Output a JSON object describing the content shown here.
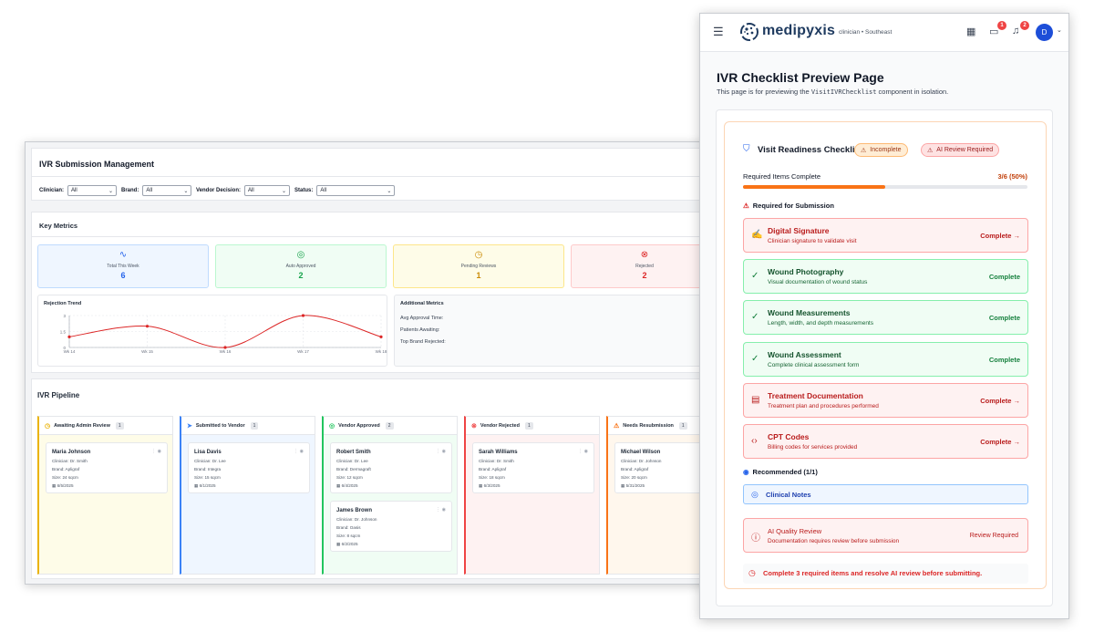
{
  "back": {
    "title": "IVR Submission Management",
    "filters": [
      {
        "label": "Clinician:",
        "value": "All"
      },
      {
        "label": "Brand:",
        "value": "All"
      },
      {
        "label": "Vendor Decision:",
        "value": "All"
      },
      {
        "label": "Status:",
        "value": "All"
      }
    ],
    "key_metrics": {
      "title": "Key Metrics",
      "cards": [
        {
          "label": "Total This Week",
          "value": "6",
          "color": "#2563eb"
        },
        {
          "label": "Auto Approved",
          "value": "2",
          "color": "#16a34a"
        },
        {
          "label": "Pending Reviews",
          "value": "1",
          "color": "#ca8a04"
        },
        {
          "label": "Rejected",
          "value": "2",
          "color": "#dc2626"
        }
      ]
    },
    "rejection_trend": {
      "title": "Rejection Trend"
    },
    "additional_metrics": {
      "title": "Additional Metrics",
      "rows": [
        "Avg Approval Time:",
        "Patients Awaiting:",
        "Top Brand Rejected:"
      ]
    },
    "pipeline": {
      "title": "IVR Pipeline",
      "columns": [
        {
          "title": "Awaiting Admin Review",
          "count": "1",
          "color": "#eab308",
          "bg": "#fefce8",
          "cards": [
            {
              "name": "Maria Johnson",
              "clinician": "Clinician: Dr. Smith",
              "brand": "Brand: Apligraf",
              "size": "Size: 24 sqcm",
              "date": "6/5/2025"
            }
          ]
        },
        {
          "title": "Submitted to Vendor",
          "count": "1",
          "color": "#3b82f6",
          "bg": "#eff6ff",
          "cards": [
            {
              "name": "Lisa Davis",
              "clinician": "Clinician: Dr. Lee",
              "brand": "Brand: Integra",
              "size": "Size: 15 sqcm",
              "date": "6/1/2025"
            }
          ]
        },
        {
          "title": "Vendor Approved",
          "count": "2",
          "color": "#22c55e",
          "bg": "#f0fdf4",
          "cards": [
            {
              "name": "Robert Smith",
              "clinician": "Clinician: Dr. Lee",
              "brand": "Brand: Dermagraft",
              "size": "Size: 12 sqcm",
              "date": "6/4/2025"
            },
            {
              "name": "James Brown",
              "clinician": "Clinician: Dr. Johnson",
              "brand": "Brand: Oasis",
              "size": "Size: 8 sqcm",
              "date": "6/2/2025"
            }
          ]
        },
        {
          "title": "Vendor Rejected",
          "count": "1",
          "color": "#ef4444",
          "bg": "#fef2f2",
          "cards": [
            {
              "name": "Sarah Williams",
              "clinician": "Clinician: Dr. Smith",
              "brand": "Brand: Apligraf",
              "size": "Size: 18 sqcm",
              "date": "6/3/2025"
            }
          ]
        },
        {
          "title": "Needs Resubmission",
          "count": "1",
          "color": "#f97316",
          "bg": "#fff7ed",
          "cards": [
            {
              "name": "Michael Wilson",
              "clinician": "Clinician: Dr. Johnson",
              "brand": "Brand: Apligraf",
              "size": "Size: 20 sqcm",
              "date": "5/31/2025"
            }
          ]
        }
      ]
    }
  },
  "chart_data": {
    "type": "line",
    "title": "Rejection Trend",
    "categories": [
      "Wk 14",
      "Wk 15",
      "Wk 16",
      "Wk 17",
      "Wk 18"
    ],
    "values": [
      1,
      2,
      0,
      3,
      1
    ],
    "yticks": [
      "0",
      "1.5",
      "3"
    ],
    "ylim": [
      0,
      3
    ],
    "color": "#dc2626",
    "grid": true
  },
  "front": {
    "brand": "medipyxis",
    "role": "clinician • Southeast",
    "badges": {
      "messages": "1",
      "notifications": "2"
    },
    "avatar": "D",
    "page_title": "IVR Checklist Preview Page",
    "subtitle_pre": "This page is for previewing the ",
    "subtitle_code": "VisitIVRChecklist",
    "subtitle_post": " component in isolation.",
    "checklist": {
      "title": "Visit Readiness Checklist",
      "pill_incomplete": "Incomplete",
      "pill_ai": "AI Review Required",
      "progress_label": "Required Items Complete",
      "progress_value": "3/6 (50%)",
      "progress_fraction": 0.5,
      "required_heading": "Required for Submission",
      "items": [
        {
          "title": "Digital Signature",
          "desc": "Clinician signature to validate visit",
          "status": "Complete →",
          "state": "red",
          "icon": "signature-icon",
          "glyph": "✍"
        },
        {
          "title": "Wound Photography",
          "desc": "Visual documentation of wound status",
          "status": "Complete",
          "state": "green",
          "icon": "check-circle-icon",
          "glyph": "✓"
        },
        {
          "title": "Wound Measurements",
          "desc": "Length, width, and depth measurements",
          "status": "Complete",
          "state": "green",
          "icon": "check-circle-icon",
          "glyph": "✓"
        },
        {
          "title": "Wound Assessment",
          "desc": "Complete clinical assessment form",
          "status": "Complete",
          "state": "green",
          "icon": "check-circle-icon",
          "glyph": "✓"
        },
        {
          "title": "Treatment Documentation",
          "desc": "Treatment plan and procedures performed",
          "status": "Complete →",
          "state": "red",
          "icon": "document-icon",
          "glyph": "▤"
        },
        {
          "title": "CPT Codes",
          "desc": "Billing codes for services provided",
          "status": "Complete →",
          "state": "red",
          "icon": "code-icon",
          "glyph": "‹›"
        }
      ],
      "recommended_heading": "Recommended (1/1)",
      "clinical_notes": "Clinical Notes",
      "ai_quality": {
        "title": "AI Quality Review",
        "desc": "Documentation requires review before submission",
        "status": "Review Required"
      },
      "footer": "Complete 3 required items and resolve AI review before submitting."
    }
  }
}
